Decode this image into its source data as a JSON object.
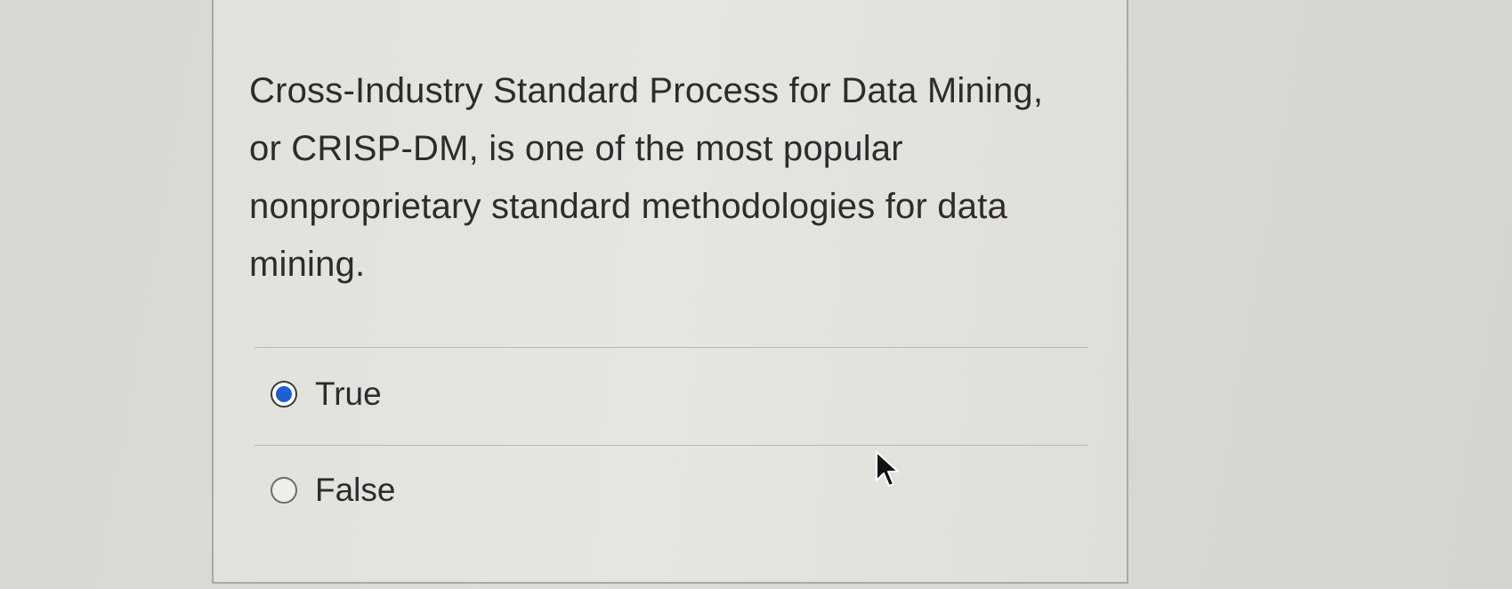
{
  "question": {
    "text": "Cross-Industry Standard Process for Data Mining, or CRISP-DM, is one of the most popular nonproprietary standard methodologies for data mining."
  },
  "options": [
    {
      "label": "True",
      "selected": true
    },
    {
      "label": "False",
      "selected": false
    }
  ],
  "colors": {
    "radio_selected": "#1f5fd6",
    "text": "#2c2c2c",
    "panel_border": "#a9a8a4"
  },
  "icons": {
    "cursor": "mouse-pointer-arrow-icon"
  }
}
